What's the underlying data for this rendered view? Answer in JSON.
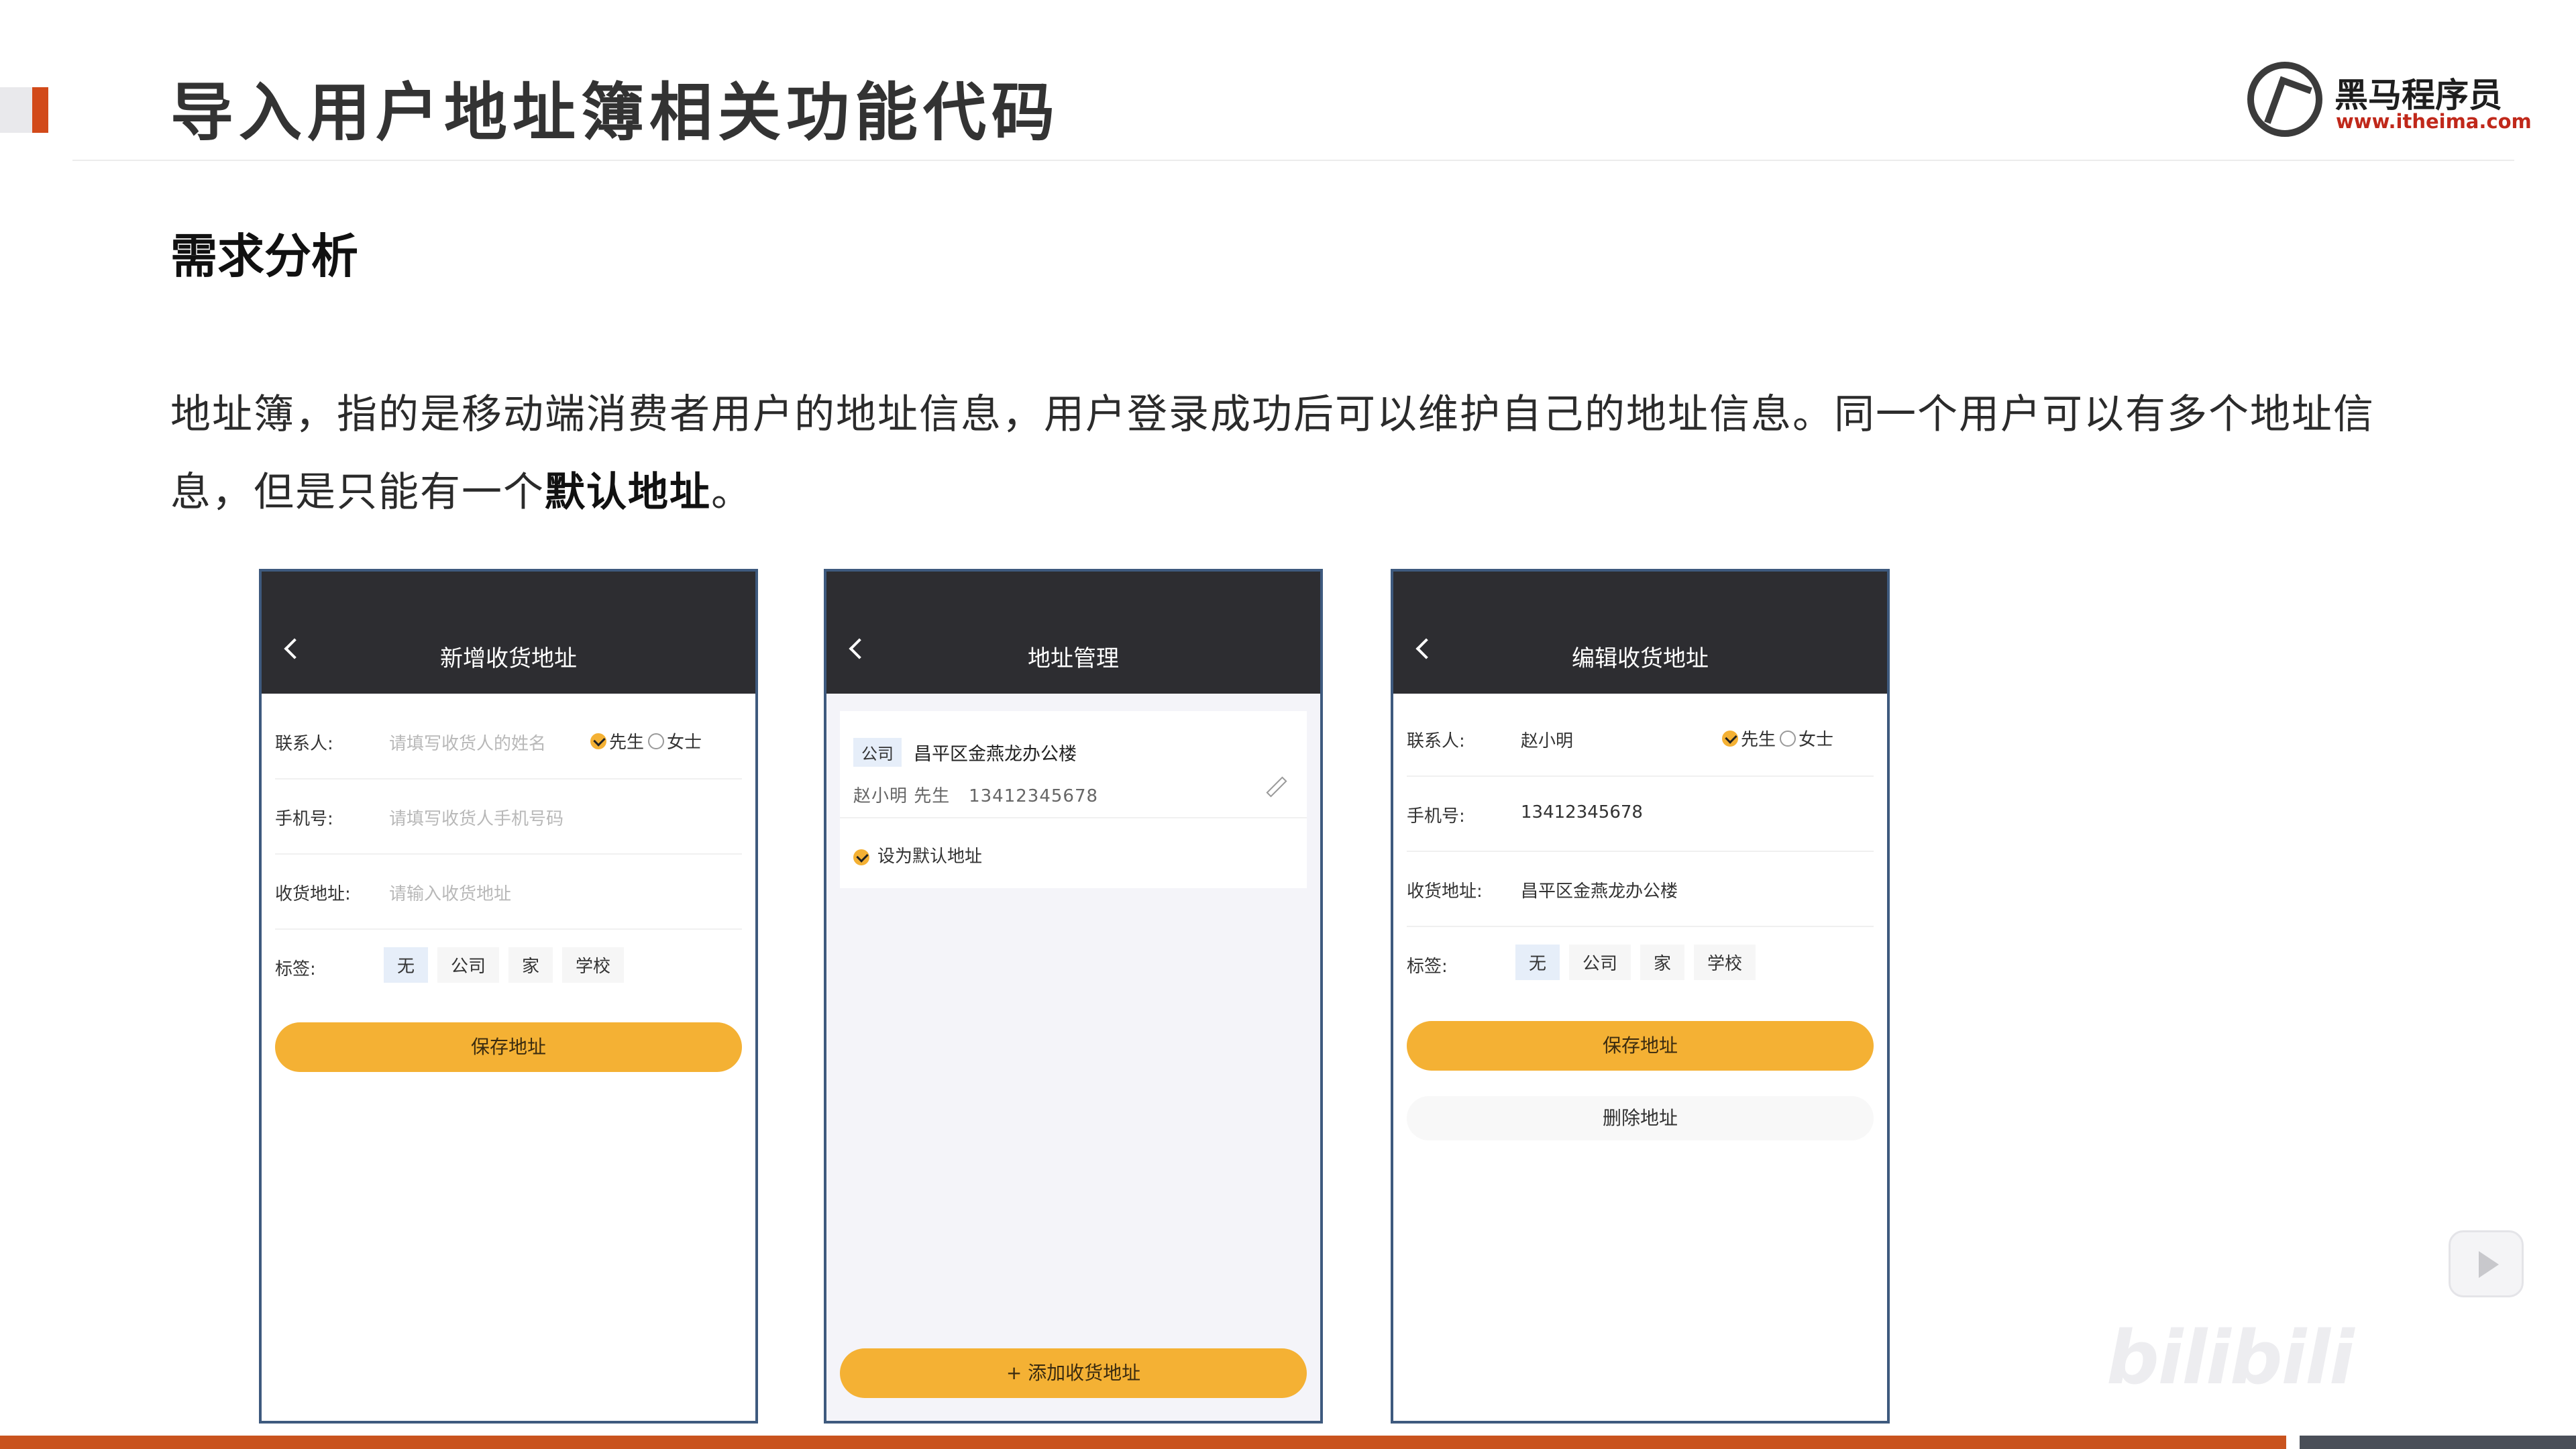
{
  "slide": {
    "title": "导入用户地址簿相关功能代码",
    "section": "需求分析",
    "paragraph_pre": "地址簿，指的是移动端消费者用户的地址信息，用户登录成功后可以维护自己的地址信息。同一个用户可以有多个地址信息，但是只能有一个",
    "paragraph_bold": "默认地址",
    "paragraph_post": "。"
  },
  "logo": {
    "name": "黑马程序员",
    "url": "www.itheima.com"
  },
  "colors": {
    "accent_red": "#d24a1a",
    "button_yellow": "#f4b134",
    "phone_header": "#2d2d31",
    "frame_blue": "#3e5a7e"
  },
  "phone_add": {
    "title": "新增收货地址",
    "contact_label": "联系人:",
    "contact_placeholder": "请填写收货人的姓名",
    "gender_male": "先生",
    "gender_female": "女士",
    "phone_label": "手机号:",
    "phone_placeholder": "请填写收货人手机号码",
    "address_label": "收货地址:",
    "address_placeholder": "请输入收货地址",
    "tag_label": "标签:",
    "tags": [
      "无",
      "公司",
      "家",
      "学校"
    ],
    "save_label": "保存地址"
  },
  "phone_manage": {
    "title": "地址管理",
    "address_tag": "公司",
    "address": "昌平区金燕龙办公楼",
    "name_line": "赵小明 先生",
    "phone": "13412345678",
    "default_label": "设为默认地址",
    "add_label": "+ 添加收货地址"
  },
  "phone_edit": {
    "title": "编辑收货地址",
    "contact_label": "联系人:",
    "contact_value": "赵小明",
    "gender_male": "先生",
    "gender_female": "女士",
    "phone_label": "手机号:",
    "phone_value": "13412345678",
    "address_label": "收货地址:",
    "address_value": "昌平区金燕龙办公楼",
    "tag_label": "标签:",
    "tags": [
      "无",
      "公司",
      "家",
      "学校"
    ],
    "save_label": "保存地址",
    "delete_label": "删除地址"
  },
  "watermark": {
    "text": "bilibili"
  }
}
